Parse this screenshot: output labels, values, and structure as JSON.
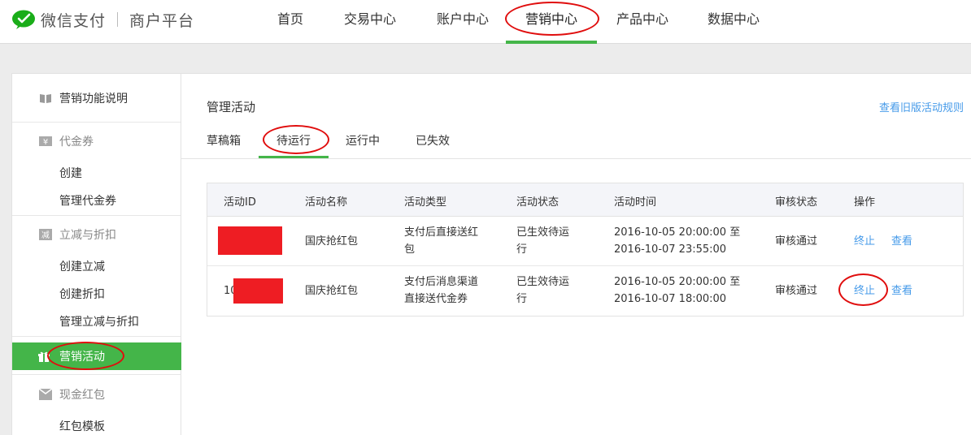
{
  "header": {
    "brand_name": "微信支付",
    "brand_sub": "商户平台",
    "nav": [
      "首页",
      "交易中心",
      "账户中心",
      "营销中心",
      "产品中心",
      "数据中心"
    ],
    "active_nav": "营销中心"
  },
  "sidebar": {
    "feature_intro": "营销功能说明",
    "groups": [
      {
        "title": "代金券",
        "icon": "voucher-icon",
        "items": [
          "创建",
          "管理代金券"
        ]
      },
      {
        "title": "立减与折扣",
        "icon": "discount-icon",
        "items": [
          "创建立减",
          "创建折扣",
          "管理立减与折扣"
        ]
      }
    ],
    "active_item": "营销活动",
    "cash_group": {
      "title": "现金红包",
      "icon": "red-packet-icon",
      "items": [
        "红包模板"
      ]
    }
  },
  "main": {
    "title": "管理活动",
    "old_rules_link": "查看旧版活动规则",
    "tabs": [
      "草稿箱",
      "待运行",
      "运行中",
      "已失效"
    ],
    "active_tab": "待运行",
    "table": {
      "columns": [
        "活动ID",
        "活动名称",
        "活动类型",
        "活动状态",
        "活动时间",
        "审核状态",
        "操作"
      ],
      "rows": [
        {
          "id": "",
          "name": "国庆抢红包",
          "type_line1": "支付后直接送红",
          "type_line2": "包",
          "status_line1": "已生效待运",
          "status_line2": "行",
          "time_line1": "2016-10-05 20:00:00 至",
          "time_line2": "2016-10-07 23:55:00",
          "review": "审核通过",
          "action_stop": "终止",
          "action_view": "查看"
        },
        {
          "id": "10",
          "name": "国庆抢红包",
          "type_line1": "支付后消息渠道",
          "type_line2": "直接送代金券",
          "status_line1": "已生效待运",
          "status_line2": "行",
          "time_line1": "2016-10-05 20:00:00 至",
          "time_line2": "2016-10-07 18:00:00",
          "review": "审核通过",
          "action_stop": "终止",
          "action_view": "查看"
        }
      ]
    }
  },
  "colors": {
    "accent_green": "#44b549",
    "link_blue": "#459ae9",
    "annotation_red": "#e00d0d",
    "redaction_red": "#ee1d23"
  }
}
